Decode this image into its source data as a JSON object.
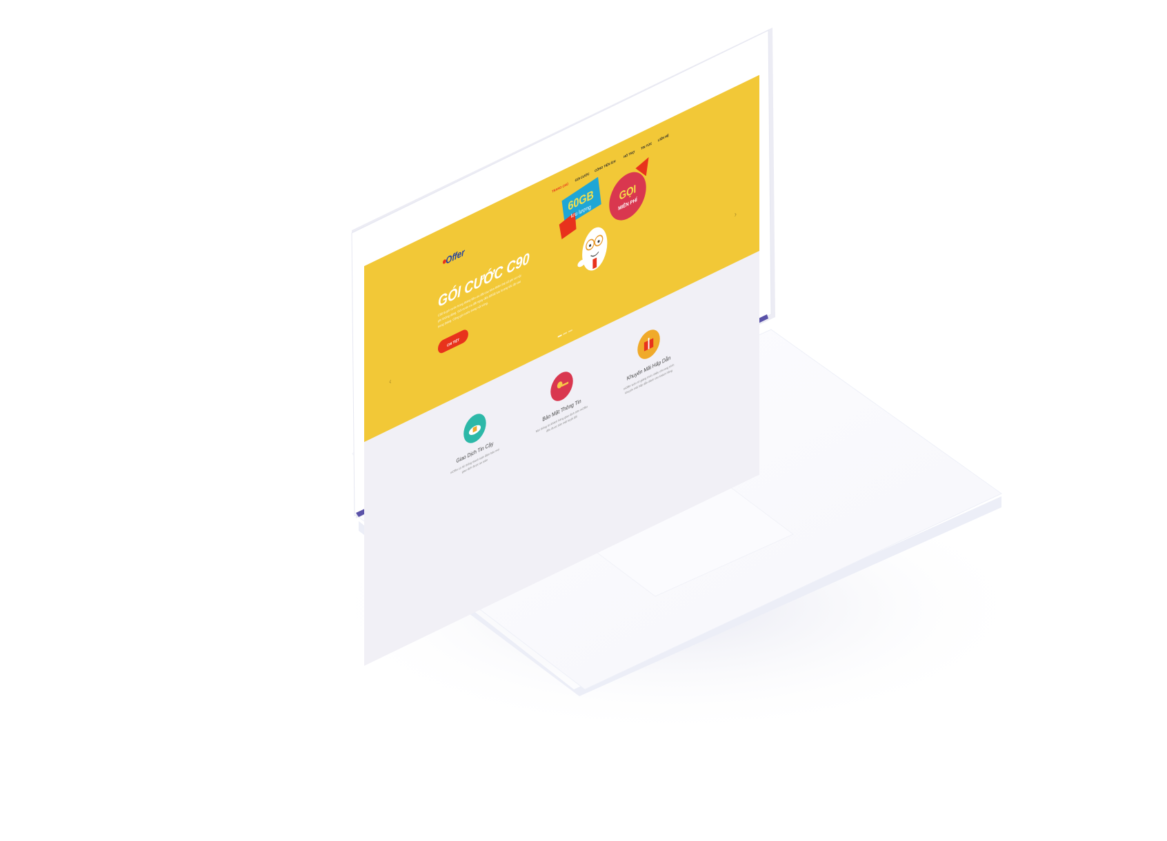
{
  "site": {
    "logo_text": "Offer",
    "nav": [
      {
        "label": "TRANG CHỦ",
        "active": true
      },
      {
        "label": "GÓI CƯỚC",
        "active": false
      },
      {
        "label": "CÔNG TIỆN ÍCH",
        "active": false
      },
      {
        "label": "HỖ TRỢ",
        "active": false
      },
      {
        "label": "TIN TỨC",
        "active": false
      },
      {
        "label": "LIÊN HỆ",
        "active": false
      }
    ],
    "hero": {
      "title": "GÓI CƯỚC C90",
      "description_lines": [
        "C90 là gói cước trong tháng tiền ưu đãi cao kèm thêm thẻ số phí có nội",
        "phí không dùng. Gói cước ưu đãi ngay đến 60GB lưu lượng tốc độ cao",
        "trong tháng. Cộng gói cước trong nội vùng."
      ],
      "cta_label": "CHI TIẾT",
      "badge_1_main": "60GB",
      "badge_1_sub": "lưu lượng",
      "badge_2_main": "GỌI",
      "badge_2_sub": "MIỄN PHÍ",
      "prev_arrow": "‹",
      "next_arrow": "›"
    },
    "features": [
      {
        "title": "Giao Dịch Tin Cậy",
        "icon": "lock-cloud-icon",
        "lines": [
          "mOffer có hệ thống thanh toán đảm bảo mọi",
          "giao dịch được an toàn"
        ]
      },
      {
        "title": "Bảo Mật Thông Tin",
        "icon": "key-icon",
        "lines": [
          "Mọi thông tin khách hàng giao dịch trên mOffer",
          "đều được bảo mật tuyệt đối"
        ]
      },
      {
        "title": "Khuyến Mãi Hấp Dẫn",
        "icon": "gift-icon",
        "lines": [
          "mOffer luôn có giảng trình nhiều chương trình",
          "khuyến mãi hấp dẫn dành cho khách hàng"
        ]
      }
    ]
  },
  "colors": {
    "hero_yellow": "#F2C837",
    "cta_red": "#E8321C",
    "nav_active": "#E8321C",
    "logo_blue": "#1F3FA0",
    "feature_teal": "#2DB8A8",
    "feature_red": "#D9374F",
    "feature_orange": "#F0AA2A"
  }
}
